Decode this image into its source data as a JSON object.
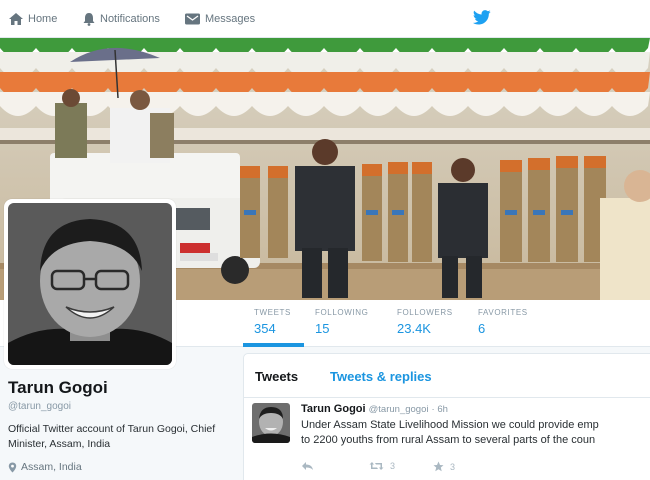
{
  "nav": {
    "home_label": "Home",
    "notifications_label": "Notifications",
    "messages_label": "Messages",
    "brand_icon": "twitter-bird-icon",
    "brand_color": "#1da1f2"
  },
  "profile": {
    "name": "Tarun Gogoi",
    "handle": "@tarun_gogoi",
    "bio": "Official Twitter account of Tarun Gogoi, Chief Minister, Assam, India",
    "location": "Assam, India"
  },
  "stats": [
    {
      "label": "TWEETS",
      "value": "354"
    },
    {
      "label": "FOLLOWING",
      "value": "15"
    },
    {
      "label": "FOLLOWERS",
      "value": "23.4K"
    },
    {
      "label": "FAVORITES",
      "value": "6"
    }
  ],
  "timeline": {
    "tabs": [
      {
        "label": "Tweets"
      },
      {
        "label": "Tweets & replies"
      }
    ],
    "tweet": {
      "author_name": "Tarun Gogoi",
      "author_handle": "@tarun_gogoi",
      "time": "· 6h",
      "text_line1": "Under Assam State Livelihood Mission we could provide emp",
      "text_line2": "to 2200 youths from rural Assam to several parts of the coun",
      "retweets": "3",
      "favorites": "3"
    }
  },
  "colors": {
    "accent": "#1b95e0",
    "muted": "#8899a6"
  }
}
